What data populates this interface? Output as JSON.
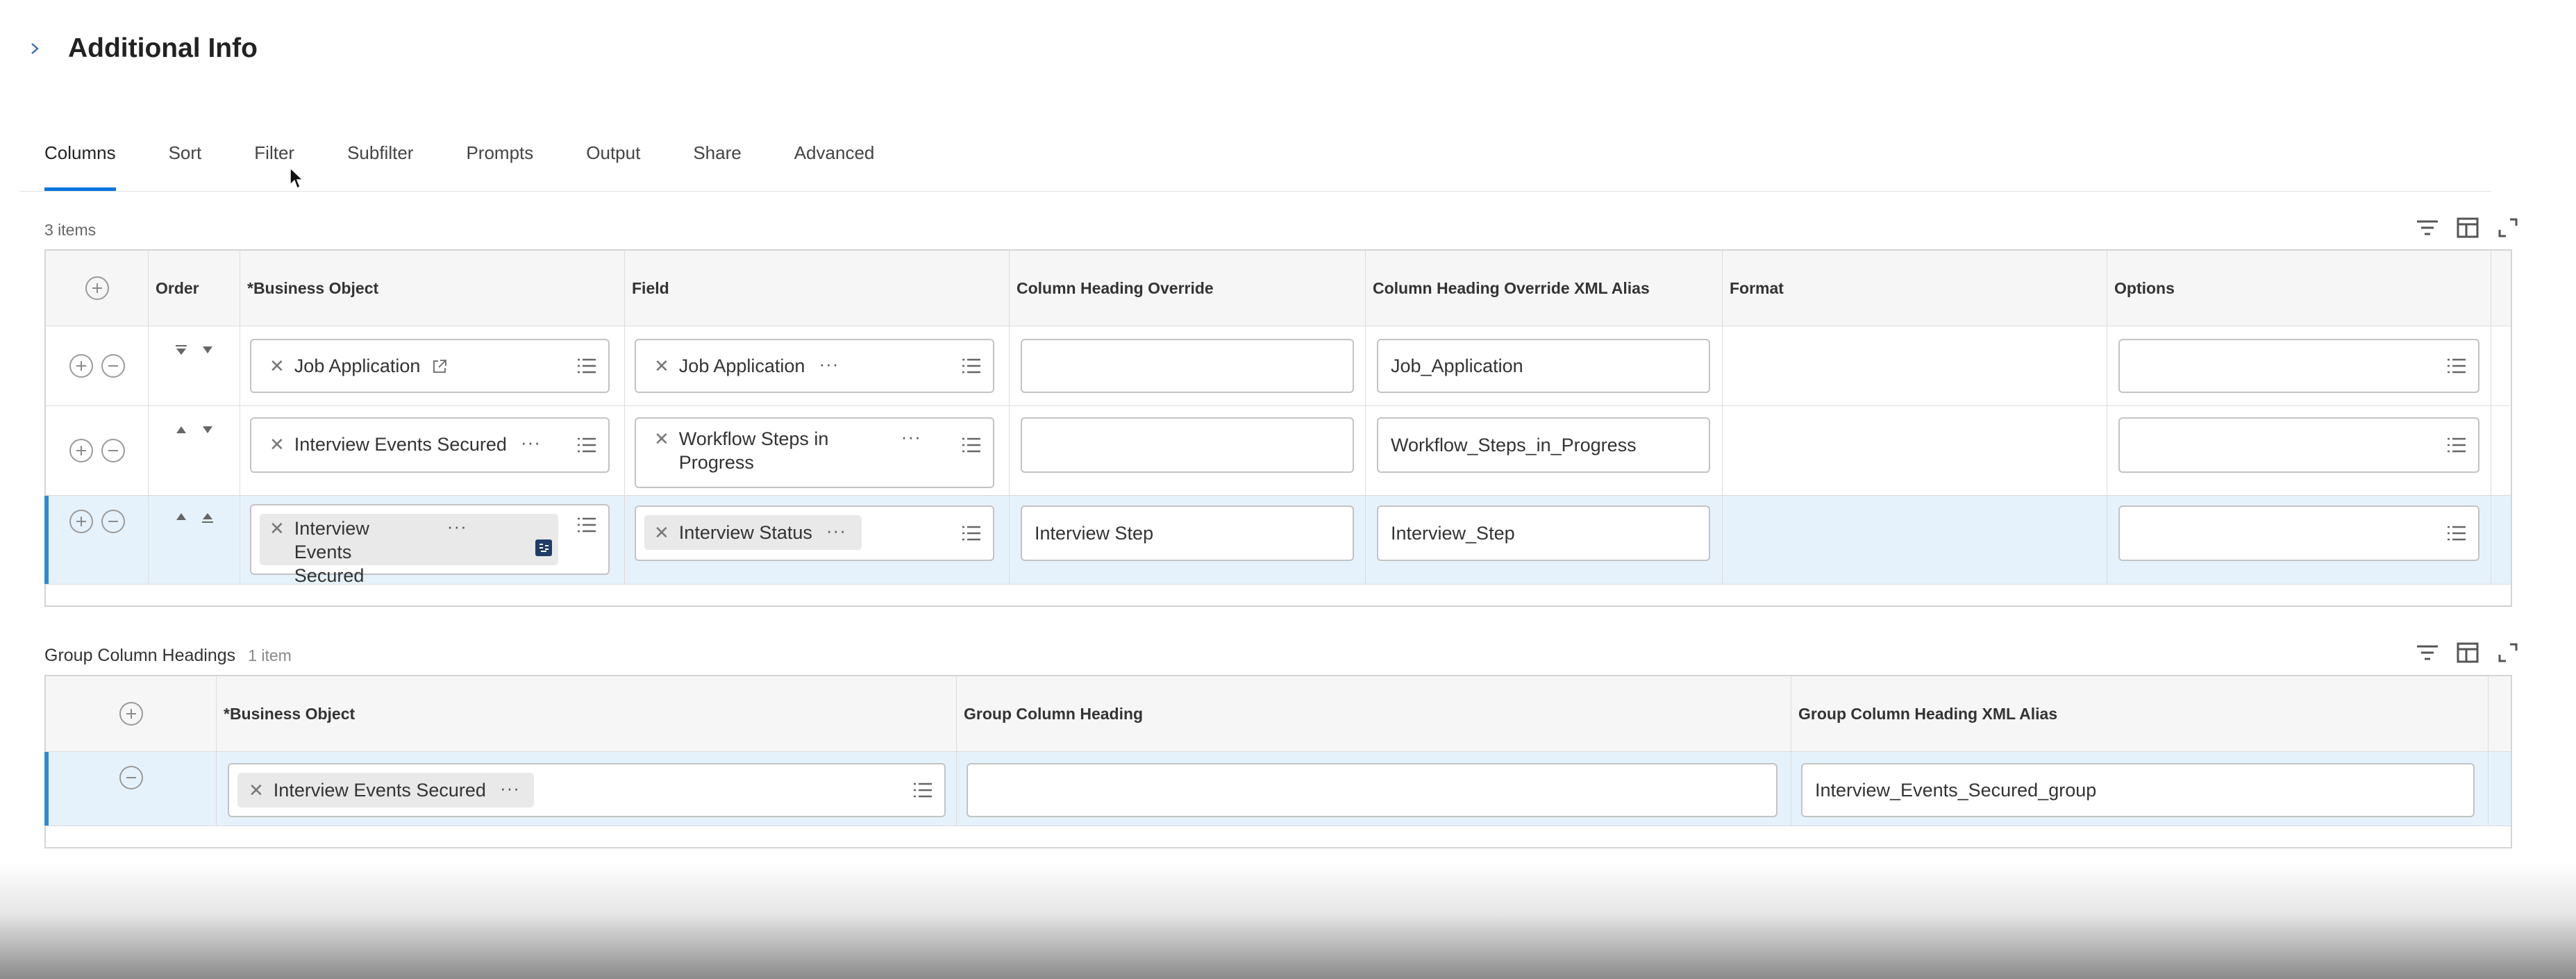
{
  "section": {
    "title": "Additional Info",
    "chevron_icon": "chevron-right-icon"
  },
  "tabs": [
    {
      "label": "Columns",
      "active": true
    },
    {
      "label": "Sort"
    },
    {
      "label": "Filter"
    },
    {
      "label": "Subfilter"
    },
    {
      "label": "Prompts"
    },
    {
      "label": "Output"
    },
    {
      "label": "Share"
    },
    {
      "label": "Advanced"
    }
  ],
  "columns_grid": {
    "count_label": "3 items",
    "headers": {
      "order": "Order",
      "business_object": "*Business Object",
      "field": "Field",
      "column_heading_override": "Column Heading Override",
      "xml_alias": "Column Heading Override XML Alias",
      "format": "Format",
      "options": "Options"
    },
    "rows": [
      {
        "business_object": "Job Application",
        "field": "Job Application",
        "field_line2": "",
        "heading_override": "",
        "xml_alias": "Job_Application"
      },
      {
        "business_object": "Interview Events Secured",
        "field": "Workflow Steps in",
        "field_line2": "Progress",
        "heading_override": "",
        "xml_alias": "Workflow_Steps_in_Progress"
      },
      {
        "business_object": "Interview Events",
        "business_object_line2": "Secured",
        "field": "Interview Status",
        "heading_override": "Interview Step",
        "xml_alias": "Interview_Step"
      }
    ]
  },
  "group_grid": {
    "title": "Group Column Headings",
    "count_label": "1 item",
    "headers": {
      "business_object": "*Business Object",
      "group_column_heading": "Group Column Heading",
      "group_xml_alias": "Group Column Heading XML Alias"
    },
    "rows": [
      {
        "business_object": "Interview Events Secured",
        "group_column_heading": "",
        "group_xml_alias": "Interview_Events_Secured_group"
      }
    ]
  },
  "colors": {
    "accent": "#0875e1",
    "selected_row": "#e6f2fb",
    "selected_bar": "#2b8bd6"
  }
}
